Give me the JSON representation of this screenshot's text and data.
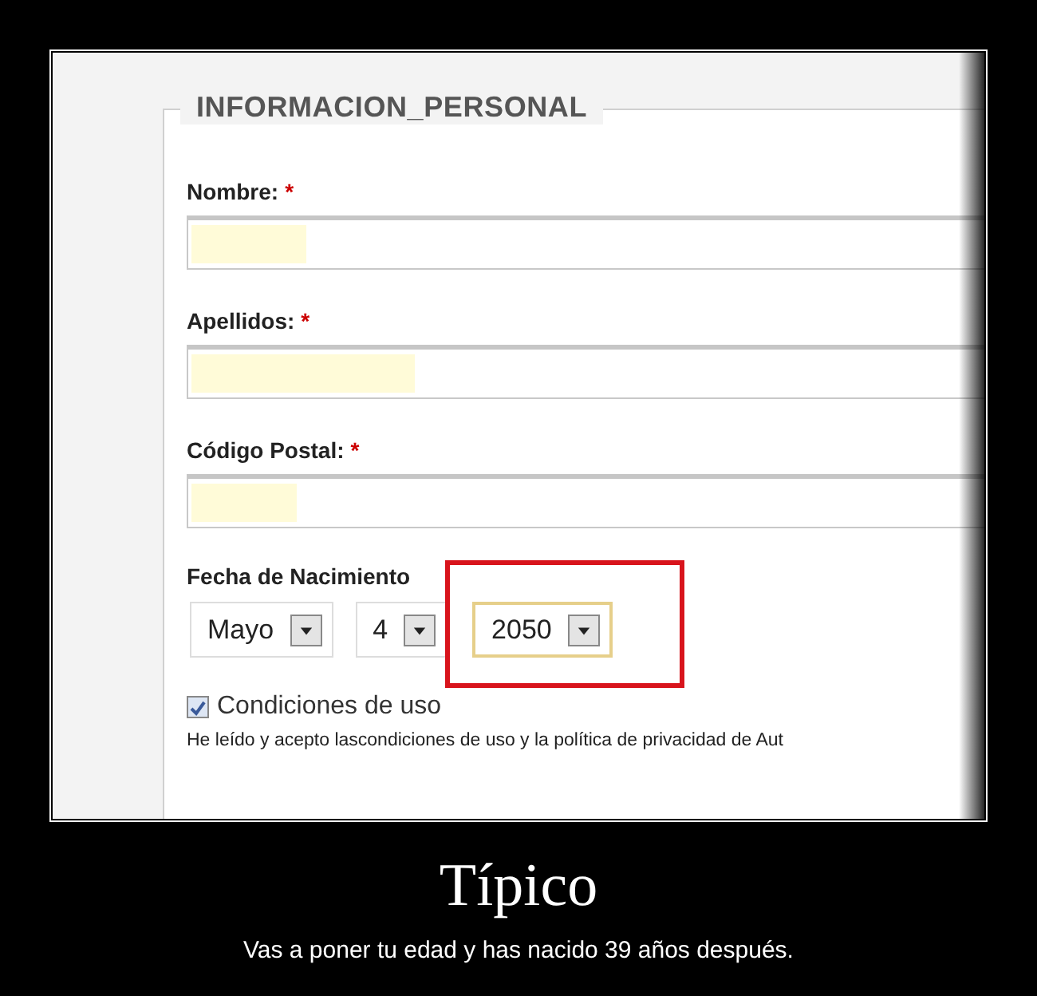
{
  "form": {
    "legend": "INFORMACION_PERSONAL",
    "fields": [
      {
        "label": "Nombre:",
        "required_mark": "*",
        "autofilled": true
      },
      {
        "label": "Apellidos:",
        "required_mark": "*",
        "autofilled": true
      },
      {
        "label": "Código Postal:",
        "required_mark": "*",
        "autofilled": true
      }
    ],
    "birth_date": {
      "label": "Fecha de Nacimiento",
      "selects": [
        {
          "value": "Mayo",
          "highlighted": false
        },
        {
          "value": "4",
          "highlighted": false
        },
        {
          "value": "2050",
          "highlighted": true
        }
      ]
    },
    "terms": {
      "label": "Condiciones de uso",
      "checked": true,
      "text": "He leído y acepto lascondiciones de uso y la política de privacidad de Aut"
    }
  },
  "poster": {
    "title": "Típico",
    "caption": "Vas a poner tu edad y has nacido 39 años después."
  }
}
